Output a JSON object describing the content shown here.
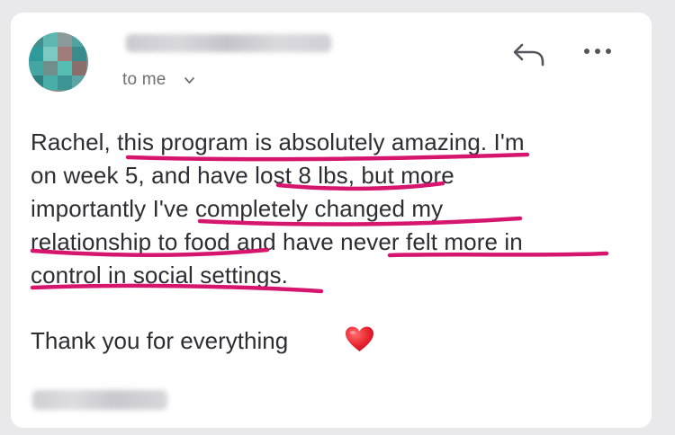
{
  "email": {
    "recipient_label": "to me",
    "body_lines": [
      "Rachel, this program is absolutely amazing. I'm",
      "on week 5, and have lost 8 lbs, but more",
      "importantly I've completely changed my",
      "relationship to food and have never felt more in",
      "control in social settings."
    ],
    "closing": "Thank you for everything"
  },
  "colors": {
    "highlight_underline": "#d6166e",
    "text": "#2e2e32",
    "muted": "#6f6f76",
    "card": "#ffffff",
    "background": "#e9e9ec"
  },
  "icons": {
    "reply": "reply-arrow-icon",
    "more": "more-dots-icon",
    "chevron": "chevron-down-icon",
    "heart": "red-heart-emoji"
  }
}
